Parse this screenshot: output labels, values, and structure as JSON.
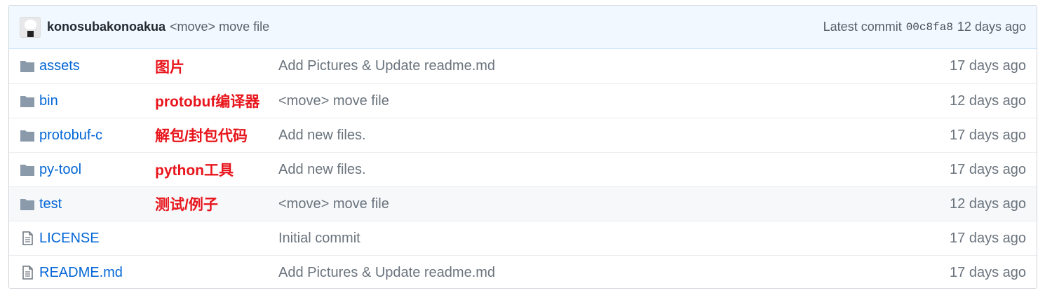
{
  "commit": {
    "author": "konosubakonoakua",
    "message": "<move> move file",
    "latest_label": "Latest commit",
    "sha": "00c8fa8",
    "age": "12 days ago"
  },
  "files": [
    {
      "type": "folder",
      "name": "assets",
      "annotation": "图片",
      "message": "Add Pictures & Update readme.md",
      "age": "17 days ago"
    },
    {
      "type": "folder",
      "name": "bin",
      "annotation": "protobuf编译器",
      "message": "<move> move file",
      "age": "12 days ago"
    },
    {
      "type": "folder",
      "name": "protobuf-c",
      "annotation": "解包/封包代码",
      "message": "Add new files.",
      "age": "17 days ago"
    },
    {
      "type": "folder",
      "name": "py-tool",
      "annotation": "python工具",
      "message": "Add new files.",
      "age": "17 days ago"
    },
    {
      "type": "folder",
      "name": "test",
      "annotation": "测试/例子",
      "message": "<move> move file",
      "age": "12 days ago"
    },
    {
      "type": "file",
      "name": "LICENSE",
      "annotation": "",
      "message": "Initial commit",
      "age": "17 days ago"
    },
    {
      "type": "file",
      "name": "README.md",
      "annotation": "",
      "message": "Add Pictures & Update readme.md",
      "age": "17 days ago"
    }
  ],
  "colors": {
    "link": "#0366d6",
    "annotation": "#e8151c",
    "folder_icon": "#79b8ff",
    "commit_bar": "#f1f8ff"
  },
  "icons": {
    "folder": "folder-icon",
    "file": "file-text-icon"
  }
}
